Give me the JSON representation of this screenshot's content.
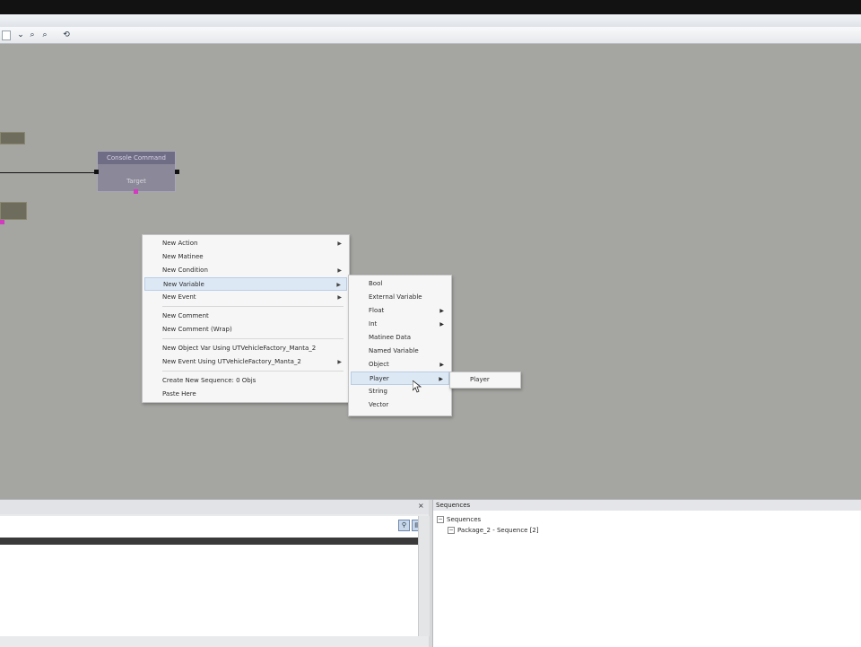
{
  "toolbar": {
    "icons": [
      "dropdown-arrow-icon",
      "zoom-icon",
      "search-icon",
      "refresh-icon"
    ],
    "dropdown_symbol": "⌄",
    "zoom_symbol": "⌕",
    "search_symbol": "⌕",
    "refresh_symbol": "⟲"
  },
  "canvas": {
    "background_color": "#a5a5a2",
    "node_stub_top": "",
    "node_stub_bottom": "",
    "console_command": {
      "title": "Console Command",
      "target_label": "Target"
    }
  },
  "context_menu": {
    "items": [
      {
        "label": "New Action",
        "submenu": true
      },
      {
        "label": "New Matinee",
        "submenu": false
      },
      {
        "label": "New Condition",
        "submenu": true
      },
      {
        "label": "New Variable",
        "submenu": true,
        "highlighted": true
      },
      {
        "label": "New Event",
        "submenu": true
      },
      {
        "label": "New Comment",
        "submenu": false
      },
      {
        "label": "New Comment (Wrap)",
        "submenu": false
      },
      {
        "label": "New Object Var Using UTVehicleFactory_Manta_2",
        "submenu": false
      },
      {
        "label": "New Event Using UTVehicleFactory_Manta_2",
        "submenu": true
      },
      {
        "label": "Create New Sequence: 0 Objs",
        "submenu": false
      },
      {
        "label": "Paste Here",
        "submenu": false
      }
    ]
  },
  "variable_menu": {
    "items": [
      {
        "label": "Bool",
        "submenu": false
      },
      {
        "label": "External Variable",
        "submenu": false
      },
      {
        "label": "Float",
        "submenu": true
      },
      {
        "label": "Int",
        "submenu": true
      },
      {
        "label": "Matinee Data",
        "submenu": false
      },
      {
        "label": "Named Variable",
        "submenu": false
      },
      {
        "label": "Object",
        "submenu": true
      },
      {
        "label": "Player",
        "submenu": true,
        "highlighted": true
      },
      {
        "label": "String",
        "submenu": false
      },
      {
        "label": "Vector",
        "submenu": false
      }
    ]
  },
  "player_menu": {
    "items": [
      {
        "label": "Player"
      }
    ]
  },
  "bottom": {
    "log_close_symbol": "×",
    "log_buttons": [
      "filter-icon",
      "clear-log-icon"
    ],
    "log_btn1_symbol": "⚲",
    "log_btn2_symbol": "▤",
    "sequences_panel_title": "Sequences",
    "tree": {
      "root_label": "Sequences",
      "child_label": "Package_2 - Sequence [2]",
      "expand_symbol": "−"
    }
  },
  "colors": {
    "menu_highlight": "#dde8f5",
    "node_title": "#6f6c85",
    "pink_port": "#d23bbf"
  }
}
